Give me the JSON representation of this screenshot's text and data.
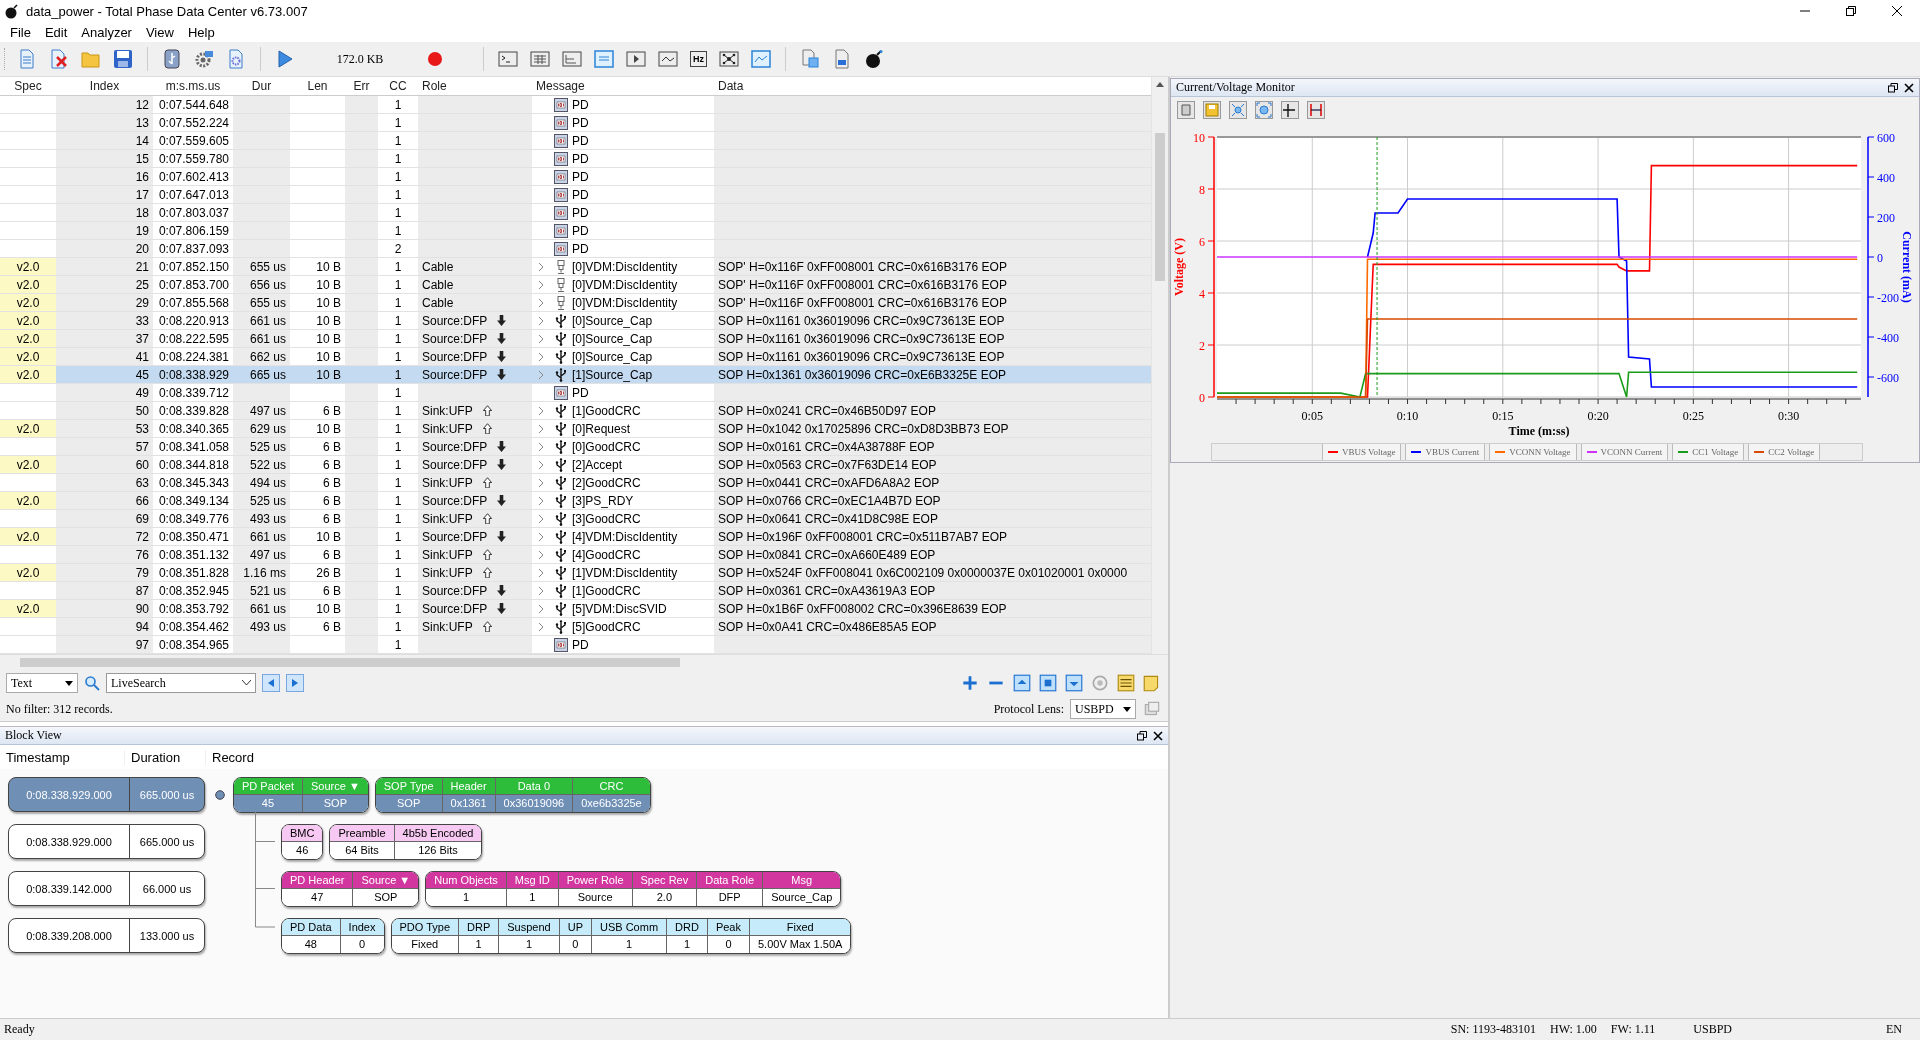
{
  "window": {
    "title": "data_power - Total Phase Data Center v6.73.007"
  },
  "menu": [
    "File",
    "Edit",
    "Analyzer",
    "View",
    "Help"
  ],
  "toolbar": {
    "capture_size": "172.0 KB",
    "frequency_label": "Hz"
  },
  "table": {
    "columns": [
      "Spec",
      "Index",
      "m:s.ms.us",
      "Dur",
      "Len",
      "Err",
      "CC",
      "Role",
      "Message",
      "Data"
    ],
    "rows": [
      {
        "index": "12",
        "time": "0:07.544.648",
        "cc": "1",
        "kind": "pd",
        "message": "PD",
        "selected": false
      },
      {
        "index": "13",
        "time": "0:07.552.224",
        "cc": "1",
        "kind": "pd",
        "message": "PD",
        "selected": false
      },
      {
        "index": "14",
        "time": "0:07.559.605",
        "cc": "1",
        "kind": "pd",
        "message": "PD",
        "selected": false
      },
      {
        "index": "15",
        "time": "0:07.559.780",
        "cc": "1",
        "kind": "pd",
        "message": "PD",
        "selected": false
      },
      {
        "index": "16",
        "time": "0:07.602.413",
        "cc": "1",
        "kind": "pd",
        "message": "PD",
        "selected": false
      },
      {
        "index": "17",
        "time": "0:07.647.013",
        "cc": "1",
        "kind": "pd",
        "message": "PD",
        "selected": false
      },
      {
        "index": "18",
        "time": "0:07.803.037",
        "cc": "1",
        "kind": "pd",
        "message": "PD",
        "selected": false
      },
      {
        "index": "19",
        "time": "0:07.806.159",
        "cc": "1",
        "kind": "pd",
        "message": "PD",
        "selected": false
      },
      {
        "index": "20",
        "time": "0:07.837.093",
        "cc": "2",
        "kind": "pd",
        "message": "PD",
        "selected": false
      },
      {
        "spec": "v2.0",
        "index": "21",
        "time": "0:07.852.150",
        "dur": "655 us",
        "len": "10 B",
        "cc": "1",
        "role": "Cable",
        "kind": "cable",
        "message": "[0]VDM:DiscIdentity",
        "data": "SOP' H=0x116F 0xFF008001 CRC=0x616B3176 EOP",
        "selected": false
      },
      {
        "spec": "v2.0",
        "index": "25",
        "time": "0:07.853.700",
        "dur": "656 us",
        "len": "10 B",
        "cc": "1",
        "role": "Cable",
        "kind": "cable",
        "message": "[0]VDM:DiscIdentity",
        "data": "SOP' H=0x116F 0xFF008001 CRC=0x616B3176 EOP",
        "selected": false
      },
      {
        "spec": "v2.0",
        "index": "29",
        "time": "0:07.855.568",
        "dur": "655 us",
        "len": "10 B",
        "cc": "1",
        "role": "Cable",
        "kind": "cable",
        "message": "[0]VDM:DiscIdentity",
        "data": "SOP' H=0x116F 0xFF008001 CRC=0x616B3176 EOP",
        "selected": false
      },
      {
        "spec": "v2.0",
        "index": "33",
        "time": "0:08.220.913",
        "dur": "661 us",
        "len": "10 B",
        "cc": "1",
        "role": "Source:DFP",
        "downstream": true,
        "kind": "usb",
        "message": "[0]Source_Cap",
        "data": "SOP H=0x1161 0x36019096 CRC=0x9C73613E EOP",
        "selected": false
      },
      {
        "spec": "v2.0",
        "index": "37",
        "time": "0:08.222.595",
        "dur": "661 us",
        "len": "10 B",
        "cc": "1",
        "role": "Source:DFP",
        "downstream": true,
        "kind": "usb",
        "message": "[0]Source_Cap",
        "data": "SOP H=0x1161 0x36019096 CRC=0x9C73613E EOP",
        "selected": false
      },
      {
        "spec": "v2.0",
        "index": "41",
        "time": "0:08.224.381",
        "dur": "662 us",
        "len": "10 B",
        "cc": "1",
        "role": "Source:DFP",
        "downstream": true,
        "kind": "usb",
        "message": "[0]Source_Cap",
        "data": "SOP H=0x1161 0x36019096 CRC=0x9C73613E EOP",
        "selected": false
      },
      {
        "spec": "v2.0",
        "index": "45",
        "time": "0:08.338.929",
        "dur": "665 us",
        "len": "10 B",
        "cc": "1",
        "role": "Source:DFP",
        "downstream": true,
        "kind": "usb",
        "message": "[1]Source_Cap",
        "data": "SOP H=0x1361 0x36019096 CRC=0xE6B3325E EOP",
        "selected": true
      },
      {
        "index": "49",
        "time": "0:08.339.712",
        "cc": "1",
        "kind": "pd",
        "message": "PD",
        "selected": false
      },
      {
        "index": "50",
        "time": "0:08.339.828",
        "dur": "497 us",
        "len": "6 B",
        "cc": "1",
        "role": "Sink:UFP",
        "downstream": false,
        "kind": "usb",
        "message": "[1]GoodCRC",
        "data": "SOP H=0x0241 CRC=0x46B50D97 EOP",
        "selected": false
      },
      {
        "spec": "v2.0",
        "index": "53",
        "time": "0:08.340.365",
        "dur": "629 us",
        "len": "10 B",
        "cc": "1",
        "role": "Sink:UFP",
        "downstream": false,
        "kind": "usb",
        "message": "[0]Request",
        "data": "SOP H=0x1042 0x17025896 CRC=0xD8D3BB73 EOP",
        "selected": false
      },
      {
        "index": "57",
        "time": "0:08.341.058",
        "dur": "525 us",
        "len": "6 B",
        "cc": "1",
        "role": "Source:DFP",
        "downstream": true,
        "kind": "usb",
        "message": "[0]GoodCRC",
        "data": "SOP H=0x0161 CRC=0x4A38788F EOP",
        "selected": false
      },
      {
        "spec": "v2.0",
        "index": "60",
        "time": "0:08.344.818",
        "dur": "522 us",
        "len": "6 B",
        "cc": "1",
        "role": "Source:DFP",
        "downstream": true,
        "kind": "usb",
        "message": "[2]Accept",
        "data": "SOP H=0x0563 CRC=0x7F63DE14 EOP",
        "selected": false
      },
      {
        "index": "63",
        "time": "0:08.345.343",
        "dur": "494 us",
        "len": "6 B",
        "cc": "1",
        "role": "Sink:UFP",
        "downstream": false,
        "kind": "usb",
        "message": "[2]GoodCRC",
        "data": "SOP H=0x0441 CRC=0xAFD6A8A2 EOP",
        "selected": false
      },
      {
        "spec": "v2.0",
        "index": "66",
        "time": "0:08.349.134",
        "dur": "525 us",
        "len": "6 B",
        "cc": "1",
        "role": "Source:DFP",
        "downstream": true,
        "kind": "usb",
        "message": "[3]PS_RDY",
        "data": "SOP H=0x0766 CRC=0xEC1A4B7D EOP",
        "selected": false
      },
      {
        "index": "69",
        "time": "0:08.349.776",
        "dur": "493 us",
        "len": "6 B",
        "cc": "1",
        "role": "Sink:UFP",
        "downstream": false,
        "kind": "usb",
        "message": "[3]GoodCRC",
        "data": "SOP H=0x0641 CRC=0x41D8C98E EOP",
        "selected": false
      },
      {
        "spec": "v2.0",
        "index": "72",
        "time": "0:08.350.471",
        "dur": "661 us",
        "len": "10 B",
        "cc": "1",
        "role": "Source:DFP",
        "downstream": true,
        "kind": "usb",
        "message": "[4]VDM:DiscIdentity",
        "data": "SOP H=0x196F 0xFF008001 CRC=0x511B7AB7 EOP",
        "selected": false
      },
      {
        "index": "76",
        "time": "0:08.351.132",
        "dur": "497 us",
        "len": "6 B",
        "cc": "1",
        "role": "Sink:UFP",
        "downstream": false,
        "kind": "usb",
        "message": "[4]GoodCRC",
        "data": "SOP H=0x0841 CRC=0xA660E489 EOP",
        "selected": false
      },
      {
        "spec": "v2.0",
        "index": "79",
        "time": "0:08.351.828",
        "dur": "1.16 ms",
        "len": "26 B",
        "cc": "1",
        "role": "Sink:UFP",
        "downstream": false,
        "kind": "usb",
        "message": "[1]VDM:DiscIdentity",
        "data": "SOP H=0x524F 0xFF008041 0x6C002109 0x0000037E 0x01020001 0x0000",
        "selected": false
      },
      {
        "index": "87",
        "time": "0:08.352.945",
        "dur": "521 us",
        "len": "6 B",
        "cc": "1",
        "role": "Source:DFP",
        "downstream": true,
        "kind": "usb",
        "message": "[1]GoodCRC",
        "data": "SOP H=0x0361 CRC=0xA43619A3 EOP",
        "selected": false
      },
      {
        "spec": "v2.0",
        "index": "90",
        "time": "0:08.353.792",
        "dur": "661 us",
        "len": "10 B",
        "cc": "1",
        "role": "Source:DFP",
        "downstream": true,
        "kind": "usb",
        "message": "[5]VDM:DiscSVID",
        "data": "SOP H=0x1B6F 0xFF008002 CRC=0x396E8639 EOP",
        "selected": false
      },
      {
        "index": "94",
        "time": "0:08.354.462",
        "dur": "493 us",
        "len": "6 B",
        "cc": "1",
        "role": "Sink:UFP",
        "downstream": false,
        "kind": "usb",
        "message": "[5]GoodCRC",
        "data": "SOP H=0x0A41 CRC=0x486E85A5 EOP",
        "selected": false
      },
      {
        "index": "97",
        "time": "0:08.354.965",
        "cc": "1",
        "kind": "pd",
        "message": "PD",
        "selected": false
      }
    ]
  },
  "search": {
    "mode": "Text",
    "value": "LiveSearch"
  },
  "filter_status": "No filter: 312 records.",
  "protocol_lens": {
    "label": "Protocol Lens:",
    "value": "USBPD"
  },
  "block_view": {
    "title": "Block View",
    "columns": [
      "Timestamp",
      "Duration",
      "Record"
    ],
    "records": [
      {
        "timestamp": "0:08.338.929.000",
        "duration": "665.000 us",
        "selected": true
      },
      {
        "timestamp": "0:08.338.929.000",
        "duration": "665.000 us",
        "selected": false
      },
      {
        "timestamp": "0:08.339.142.000",
        "duration": "66.000 us",
        "selected": false
      },
      {
        "timestamp": "0:08.339.208.000",
        "duration": "133.000 us",
        "selected": false
      }
    ],
    "tree": {
      "selected": true,
      "groups": [
        {
          "color": "#2dbd3a",
          "cells": [
            {
              "header": "PD Packet",
              "value": "45"
            },
            {
              "header": "Source ▼",
              "value": "SOP"
            }
          ]
        },
        {
          "color": "#2dbd3a",
          "cells": [
            {
              "header": "SOP Type",
              "value": "SOP"
            },
            {
              "header": "Header",
              "value": "0x1361"
            },
            {
              "header": "Data 0",
              "value": "0x36019096"
            },
            {
              "header": "CRC",
              "value": "0xe6b3325e"
            }
          ]
        }
      ],
      "children": [
        {
          "selected": false,
          "groups": [
            {
              "color": "#f7c9f2",
              "cells": [
                {
                  "header": "BMC",
                  "value": "46"
                }
              ]
            },
            {
              "color": "#f7c9f2",
              "cells": [
                {
                  "header": "Preamble",
                  "value": "64 Bits"
                },
                {
                  "header": "4b5b Encoded",
                  "value": "126 Bits"
                }
              ]
            }
          ]
        },
        {
          "selected": false,
          "groups": [
            {
              "color": "#d2379f",
              "cells": [
                {
                  "header": "PD Header",
                  "value": "47"
                },
                {
                  "header": "Source ▼",
                  "value": "SOP"
                }
              ]
            },
            {
              "color": "#d2379f",
              "cells": [
                {
                  "header": "Num Objects",
                  "value": "1"
                },
                {
                  "header": "Msg ID",
                  "value": "1"
                },
                {
                  "header": "Power Role",
                  "value": "Source"
                },
                {
                  "header": "Spec Rev",
                  "value": "2.0"
                },
                {
                  "header": "Data Role",
                  "value": "DFP"
                },
                {
                  "header": "Msg",
                  "value": "Source_Cap"
                }
              ]
            }
          ]
        },
        {
          "selected": false,
          "groups": [
            {
              "color": "#c6ebfa",
              "cells": [
                {
                  "header": "PD Data",
                  "value": "48"
                },
                {
                  "header": "Index",
                  "value": "0"
                }
              ]
            },
            {
              "color": "#c6ebfa",
              "cells": [
                {
                  "header": "PDO Type",
                  "value": "Fixed"
                },
                {
                  "header": "DRP",
                  "value": "1"
                },
                {
                  "header": "Suspend",
                  "value": "1"
                },
                {
                  "header": "UP",
                  "value": "0"
                },
                {
                  "header": "USB Comm",
                  "value": "1"
                },
                {
                  "header": "DRD",
                  "value": "1"
                },
                {
                  "header": "Peak",
                  "value": "0"
                },
                {
                  "header": "Fixed",
                  "value": "5.00V Max 1.50A"
                }
              ]
            }
          ]
        }
      ]
    }
  },
  "monitor": {
    "title": "Current/Voltage Monitor",
    "chart_data": {
      "type": "line",
      "xlabel": "Time (m:ss)",
      "ylabel": "Voltage (V)",
      "y2label": "Current (mA)",
      "x": [
        0,
        6.5,
        7.5,
        7.8,
        7.9,
        8.2,
        8.3,
        9.5,
        10,
        21,
        21.1,
        21.5,
        21.6,
        22.7,
        22.8,
        33.6
      ],
      "xlim": [
        0,
        33.8
      ],
      "ylim": [
        0,
        10
      ],
      "y2lim": [
        -700,
        600
      ],
      "xticks": [
        {
          "value": 5,
          "label": "0:05"
        },
        {
          "value": 10,
          "label": "0:10"
        },
        {
          "value": 15,
          "label": "0:15"
        },
        {
          "value": 20,
          "label": "0:20"
        },
        {
          "value": 25,
          "label": "0:25"
        },
        {
          "value": 30,
          "label": "0:30"
        }
      ],
      "yticks": [
        0,
        2,
        4,
        6,
        8,
        10
      ],
      "y2ticks": [
        -600,
        -400,
        -200,
        0,
        200,
        400,
        600
      ],
      "series": [
        {
          "name": "VBUS Voltage",
          "color": "#ff0000",
          "values": [
            null,
            null,
            0,
            0,
            0,
            5.1,
            5.1,
            5.1,
            5.1,
            5.1,
            5.0,
            4.85,
            4.85,
            4.85,
            8.9,
            8.9
          ]
        },
        {
          "name": "VBUS Current",
          "color": "#0000ff",
          "axis": "y2",
          "values": [
            null,
            null,
            null,
            null,
            0,
            120,
            220,
            220,
            290,
            290,
            0,
            -20,
            -500,
            -510,
            -650,
            -650
          ]
        },
        {
          "name": "VCONN Voltage",
          "color": "#ff6a00",
          "values": [
            0,
            0,
            0,
            0,
            5.3,
            5.3,
            5.3,
            5.3,
            5.3,
            5.3,
            5.3,
            5.3,
            5.3,
            5.3,
            5.3,
            5.3
          ]
        },
        {
          "name": "VCONN Current",
          "color": "#cc33ff",
          "axis": "y2",
          "values": [
            0,
            0,
            0,
            0,
            0,
            0,
            0,
            0,
            0,
            0,
            0,
            0,
            0,
            0,
            0,
            0
          ]
        },
        {
          "name": "CC1 Voltage",
          "color": "#1a9c1a",
          "values": [
            0.15,
            0.15,
            0,
            0.9,
            0.9,
            0.9,
            0.9,
            0.9,
            0.9,
            0.9,
            0.9,
            0,
            0.95,
            0.95,
            0.95,
            0.95
          ]
        },
        {
          "name": "CC2 Voltage",
          "color": "#d94a00",
          "values": [
            0,
            0,
            0,
            0,
            3,
            3,
            3,
            3,
            3,
            3,
            3,
            3,
            3,
            3,
            3,
            3
          ]
        }
      ],
      "grid": true,
      "legend": "bottom",
      "ref_lines": [
        {
          "axis": "x",
          "value": 8.4,
          "color": "#1a9c1a"
        }
      ]
    }
  },
  "status_bar": {
    "message": "Ready",
    "serial": "SN: 1193-483101",
    "hardware": "HW: 1.00",
    "firmware": "FW: 1.11",
    "protocol": "USBPD",
    "language": "EN"
  }
}
